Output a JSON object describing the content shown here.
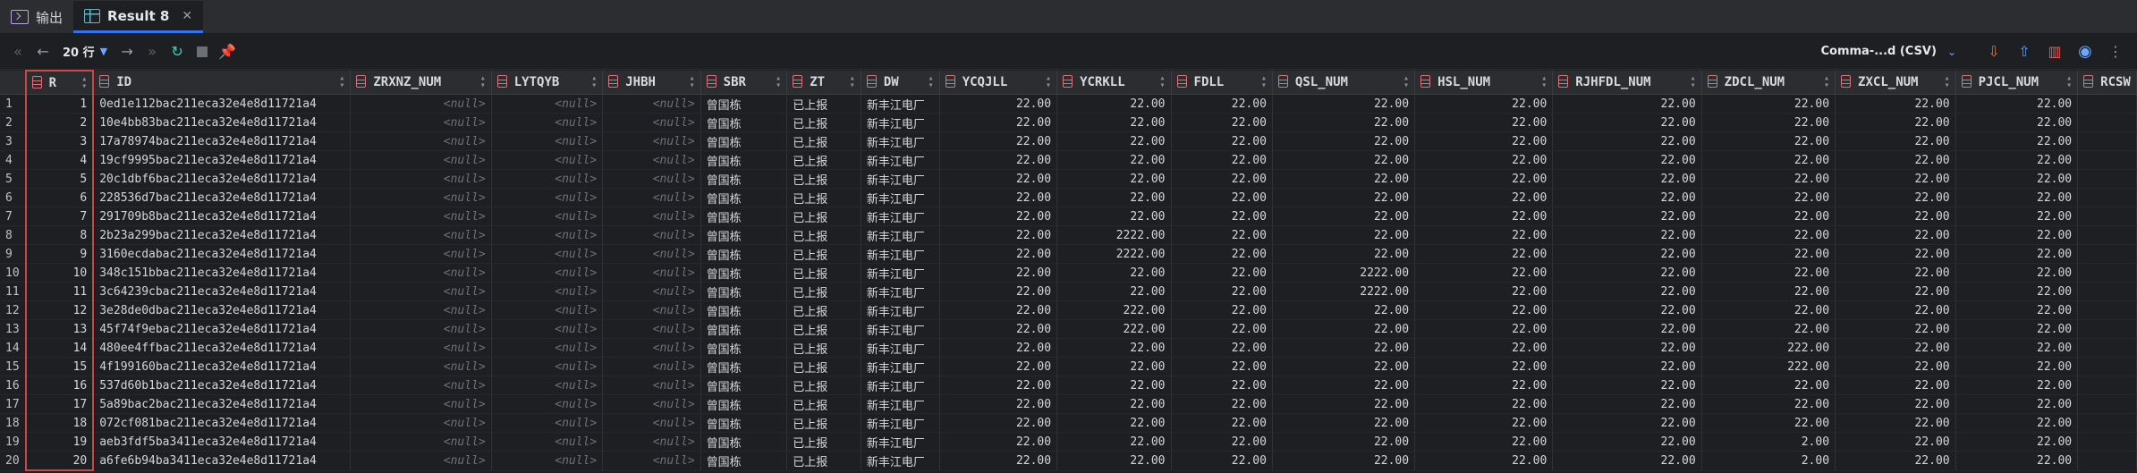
{
  "tabs": [
    {
      "label": "输出",
      "icon": "terminal-icon"
    },
    {
      "label": "Result 8",
      "icon": "grid-icon"
    }
  ],
  "toolbar": {
    "rows_label": "20 行",
    "format_label": "Comma-...d (CSV)"
  },
  "columns": [
    "R",
    "ID",
    "ZRXNZ_NUM",
    "LYTQYB",
    "JHBH",
    "SBR",
    "ZT",
    "DW",
    "YCQJLL",
    "YCRKLL",
    "FDLL",
    "QSL_NUM",
    "HSL_NUM",
    "RJHFDL_NUM",
    "ZDCL_NUM",
    "ZXCL_NUM",
    "PJCL_NUM",
    "RCSW"
  ],
  "null_text": "<null>",
  "rows": [
    {
      "n": "1",
      "r": "1",
      "id": "0ed1e112bac211eca32e4e8d11721a4",
      "sbr": "曾国栋",
      "zt": "已上报",
      "dw": "新丰江电厂",
      "v": [
        "22.00",
        "22.00",
        "22.00",
        "22.00",
        "22.00",
        "22.00",
        "22.00",
        "22.00",
        "22.00"
      ]
    },
    {
      "n": "2",
      "r": "2",
      "id": "10e4bb83bac211eca32e4e8d11721a4",
      "sbr": "曾国栋",
      "zt": "已上报",
      "dw": "新丰江电厂",
      "v": [
        "22.00",
        "22.00",
        "22.00",
        "22.00",
        "22.00",
        "22.00",
        "22.00",
        "22.00",
        "22.00"
      ]
    },
    {
      "n": "3",
      "r": "3",
      "id": "17a78974bac211eca32e4e8d11721a4",
      "sbr": "曾国栋",
      "zt": "已上报",
      "dw": "新丰江电厂",
      "v": [
        "22.00",
        "22.00",
        "22.00",
        "22.00",
        "22.00",
        "22.00",
        "22.00",
        "22.00",
        "22.00"
      ]
    },
    {
      "n": "4",
      "r": "4",
      "id": "19cf9995bac211eca32e4e8d11721a4",
      "sbr": "曾国栋",
      "zt": "已上报",
      "dw": "新丰江电厂",
      "v": [
        "22.00",
        "22.00",
        "22.00",
        "22.00",
        "22.00",
        "22.00",
        "22.00",
        "22.00",
        "22.00"
      ]
    },
    {
      "n": "5",
      "r": "5",
      "id": "20c1dbf6bac211eca32e4e8d11721a4",
      "sbr": "曾国栋",
      "zt": "已上报",
      "dw": "新丰江电厂",
      "v": [
        "22.00",
        "22.00",
        "22.00",
        "22.00",
        "22.00",
        "22.00",
        "22.00",
        "22.00",
        "22.00"
      ]
    },
    {
      "n": "6",
      "r": "6",
      "id": "22853 6d7bac211eca32e4e8d11721a4",
      "sbr": "曾国栋",
      "zt": "已上报",
      "dw": "新丰江电厂",
      "v": [
        "22.00",
        "22.00",
        "22.00",
        "22.00",
        "22.00",
        "22.00",
        "22.00",
        "22.00",
        "22.00"
      ]
    },
    {
      "n": "7",
      "r": "7",
      "id": "291709b8bac211eca32e4e8d11721a4",
      "sbr": "曾国栋",
      "zt": "已上报",
      "dw": "新丰江电厂",
      "v": [
        "22.00",
        "22.00",
        "22.00",
        "22.00",
        "22.00",
        "22.00",
        "22.00",
        "22.00",
        "22.00"
      ]
    },
    {
      "n": "8",
      "r": "8",
      "id": "2b23a299bac211eca32e4e8d11721a4",
      "sbr": "曾国栋",
      "zt": "已上报",
      "dw": "新丰江电厂",
      "v": [
        "22.00",
        "2222.00",
        "22.00",
        "22.00",
        "22.00",
        "22.00",
        "22.00",
        "22.00",
        "22.00"
      ]
    },
    {
      "n": "9",
      "r": "9",
      "id": "3160ecdabac211eca32e4e8d11721a4",
      "sbr": "曾国栋",
      "zt": "已上报",
      "dw": "新丰江电厂",
      "v": [
        "22.00",
        "2222.00",
        "22.00",
        "22.00",
        "22.00",
        "22.00",
        "22.00",
        "22.00",
        "22.00"
      ]
    },
    {
      "n": "10",
      "r": "10",
      "id": "348c151bbac211eca32e4e8d11721a4",
      "sbr": "曾国栋",
      "zt": "已上报",
      "dw": "新丰江电厂",
      "v": [
        "22.00",
        "22.00",
        "22.00",
        "2222.00",
        "22.00",
        "22.00",
        "22.00",
        "22.00",
        "22.00"
      ]
    },
    {
      "n": "11",
      "r": "11",
      "id": "3c64239cbac211eca32e4e8d11721a4",
      "sbr": "曾国栋",
      "zt": "已上报",
      "dw": "新丰江电厂",
      "v": [
        "22.00",
        "22.00",
        "22.00",
        "2222.00",
        "22.00",
        "22.00",
        "22.00",
        "22.00",
        "22.00"
      ]
    },
    {
      "n": "12",
      "r": "12",
      "id": "3e28de0dbac211eca32e4e8d11721a4",
      "sbr": "曾国栋",
      "zt": "已上报",
      "dw": "新丰江电厂",
      "v": [
        "22.00",
        "222.00",
        "22.00",
        "22.00",
        "22.00",
        "22.00",
        "22.00",
        "22.00",
        "22.00"
      ]
    },
    {
      "n": "13",
      "r": "13",
      "id": "45f74f9ebac211eca32e4e8d11721a4",
      "sbr": "曾国栋",
      "zt": "已上报",
      "dw": "新丰江电厂",
      "v": [
        "22.00",
        "222.00",
        "22.00",
        "22.00",
        "22.00",
        "22.00",
        "22.00",
        "22.00",
        "22.00"
      ]
    },
    {
      "n": "14",
      "r": "14",
      "id": "480ee4ffbac211eca32e4e8d11721a4",
      "sbr": "曾国栋",
      "zt": "已上报",
      "dw": "新丰江电厂",
      "v": [
        "22.00",
        "22.00",
        "22.00",
        "22.00",
        "22.00",
        "22.00",
        "222.00",
        "22.00",
        "22.00"
      ]
    },
    {
      "n": "15",
      "r": "15",
      "id": "4f199160bac211eca32e4e8d11721a4",
      "sbr": "曾国栋",
      "zt": "已上报",
      "dw": "新丰江电厂",
      "v": [
        "22.00",
        "22.00",
        "22.00",
        "22.00",
        "22.00",
        "22.00",
        "222.00",
        "22.00",
        "22.00"
      ]
    },
    {
      "n": "16",
      "r": "16",
      "id": "537d60b1bac211eca32e4e8d11721a4",
      "sbr": "曾国栋",
      "zt": "已上报",
      "dw": "新丰江电厂",
      "v": [
        "22.00",
        "22.00",
        "22.00",
        "22.00",
        "22.00",
        "22.00",
        "22.00",
        "22.00",
        "22.00"
      ]
    },
    {
      "n": "17",
      "r": "17",
      "id": "5a89bac2bac211eca32e4e8d11721a4",
      "sbr": "曾国栋",
      "zt": "已上报",
      "dw": "新丰江电厂",
      "v": [
        "22.00",
        "22.00",
        "22.00",
        "22.00",
        "22.00",
        "22.00",
        "22.00",
        "22.00",
        "22.00"
      ]
    },
    {
      "n": "18",
      "r": "18",
      "id": "072cf081bac211eca32e4e8d11721a4",
      "sbr": "曾国栋",
      "zt": "已上报",
      "dw": "新丰江电厂",
      "v": [
        "22.00",
        "22.00",
        "22.00",
        "22.00",
        "22.00",
        "22.00",
        "22.00",
        "22.00",
        "22.00"
      ]
    },
    {
      "n": "19",
      "r": "19",
      "id": "aeb3fdf5ba3411eca32e4e8d11721a4",
      "sbr": "曾国栋",
      "zt": "已上报",
      "dw": "新丰江电厂",
      "v": [
        "22.00",
        "22.00",
        "22.00",
        "22.00",
        "22.00",
        "22.00",
        "2.00",
        "22.00",
        "22.00"
      ]
    },
    {
      "n": "20",
      "r": "20",
      "id": "a6fe6b94ba3411eca32e4e8d11721a4",
      "sbr": "曾国栋",
      "zt": "已上报",
      "dw": "新丰江电厂",
      "v": [
        "22.00",
        "22.00",
        "22.00",
        "22.00",
        "22.00",
        "22.00",
        "2.00",
        "22.00",
        "22.00"
      ]
    }
  ]
}
